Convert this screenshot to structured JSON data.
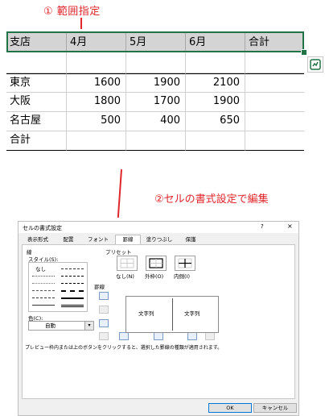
{
  "annotations": {
    "step1": "① 範囲指定",
    "step2": "②セルの書式設定で編集"
  },
  "sheet": {
    "header_row": [
      "支店",
      "4月",
      "5月",
      "6月",
      "合計"
    ],
    "rows": [
      [
        "",
        "",
        "",
        "",
        ""
      ],
      [
        "東京",
        "1600",
        "1900",
        "2100",
        ""
      ],
      [
        "大阪",
        "1800",
        "1700",
        "1900",
        ""
      ],
      [
        "名古屋",
        "500",
        "400",
        "650",
        ""
      ],
      [
        "合計",
        "",
        "",
        "",
        ""
      ]
    ],
    "selection_color": "#217346",
    "quick_analysis_icon": "quick-analysis-icon"
  },
  "dialog": {
    "title": "セルの書式設定",
    "help": "?",
    "close": "×",
    "tabs": [
      "表示形式",
      "配置",
      "フォント",
      "罫線",
      "塗りつぶし",
      "保護"
    ],
    "active_tab": "罫線",
    "line_section": "線",
    "style_label": "スタイル(S):",
    "style_none": "なし",
    "color_label": "色(C):",
    "color_value": "自動",
    "preset_label": "プリセット",
    "presets": [
      "なし(N)",
      "外枠(O)",
      "内側(I)"
    ],
    "border_label": "罫線",
    "preview_left": "文字列",
    "preview_right": "文字列",
    "footnote": "プレビュー枠内または上のボタンをクリックすると、選択した罫線の種類が適用されます。",
    "ok": "OK",
    "cancel": "キャンセル"
  }
}
